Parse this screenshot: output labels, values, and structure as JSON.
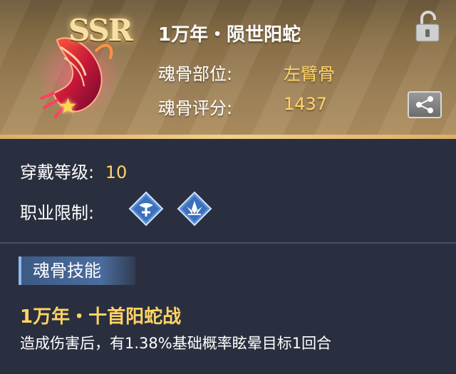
{
  "item": {
    "rarity": "SSR",
    "name": "1万年・陨世阳蛇",
    "stars": "★"
  },
  "attributes": {
    "part_label": "魂骨部位:",
    "part_value": "左臂骨",
    "score_label": "魂骨评分:",
    "score_value": "1437"
  },
  "requirements": {
    "level_label": "穿戴等级:",
    "level_value": "10",
    "class_label": "职业限制:",
    "class_icons": [
      "healer-class-icon",
      "lotus-class-icon"
    ]
  },
  "skill": {
    "section_label": "魂骨技能",
    "name": "1万年・十首阳蛇战",
    "description": "造成伤害后，有1.38%基础概率眩晕目标1回合"
  },
  "colors": {
    "accent": "#ffd466",
    "header_gold": "#a0845a",
    "panel_bg": "#2a2f3f",
    "skill_tag": "#4b6d9d"
  }
}
